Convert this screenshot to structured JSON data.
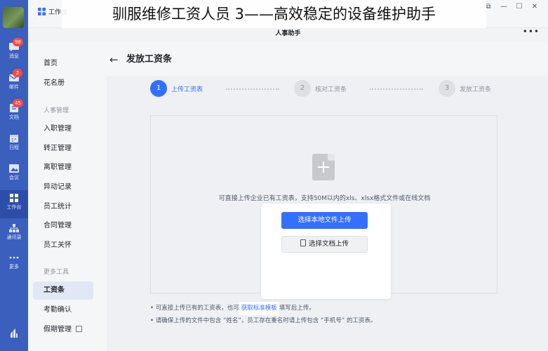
{
  "overlay_title": "驯服维修工资人员 3——高效稳定的设备维护助手",
  "appbar": {
    "items": [
      {
        "label": "消息",
        "icon": "chat-icon",
        "badge": "98"
      },
      {
        "label": "邮件",
        "icon": "mail-icon",
        "badge": "2"
      },
      {
        "label": "文档",
        "icon": "docs-icon",
        "badge": "45"
      },
      {
        "label": "日程",
        "icon": "calendar-icon",
        "badge": ""
      },
      {
        "label": "会议",
        "icon": "meeting-icon",
        "badge": ""
      },
      {
        "label": "工作台",
        "icon": "workspace-icon",
        "badge": ""
      },
      {
        "label": "通讯录",
        "icon": "contacts-icon",
        "badge": ""
      },
      {
        "label": "更多",
        "icon": "more-icon",
        "badge": ""
      }
    ]
  },
  "topbar": {
    "workspace_tab": "工作台"
  },
  "app_header": {
    "name": "人事助手",
    "more": "•••"
  },
  "sidenav": {
    "items": {
      "home": "首页",
      "roster": "花名册"
    },
    "group_hr": "人事管理",
    "hr_items": [
      "入职管理",
      "转正管理",
      "离职管理",
      "异动记录",
      "员工统计",
      "合同管理",
      "员工关怀"
    ],
    "group_tools": "更多工具",
    "tool_items": [
      "工资条",
      "考勤确认",
      "假期管理"
    ]
  },
  "main": {
    "title": "发放工资条",
    "steps": [
      {
        "num": "1",
        "label": "上传工资表",
        "active": true
      },
      {
        "num": "2",
        "label": "核对工资条",
        "active": false
      },
      {
        "num": "3",
        "label": "发放工资条",
        "active": false
      }
    ],
    "drop_text": "可直接上传企业已有工资表，支持50M以内的xls、xlsx格式文件或在线文档",
    "btn_local": "选择本地文件上传",
    "btn_doc": "选择文档上传",
    "note1_prefix": "• 可直接上传已有的工资表，也可",
    "note1_link": "获取标准模板",
    "note1_suffix": "填写后上传。",
    "note2": "• 请确保上传的文件中包含 “姓名”，员工存在重名时请上传包含 “手机号” 的工资表。"
  },
  "colors": {
    "appbar_bg": "#3a5fbd",
    "primary": "#3370ff",
    "badge": "#f54a45"
  }
}
